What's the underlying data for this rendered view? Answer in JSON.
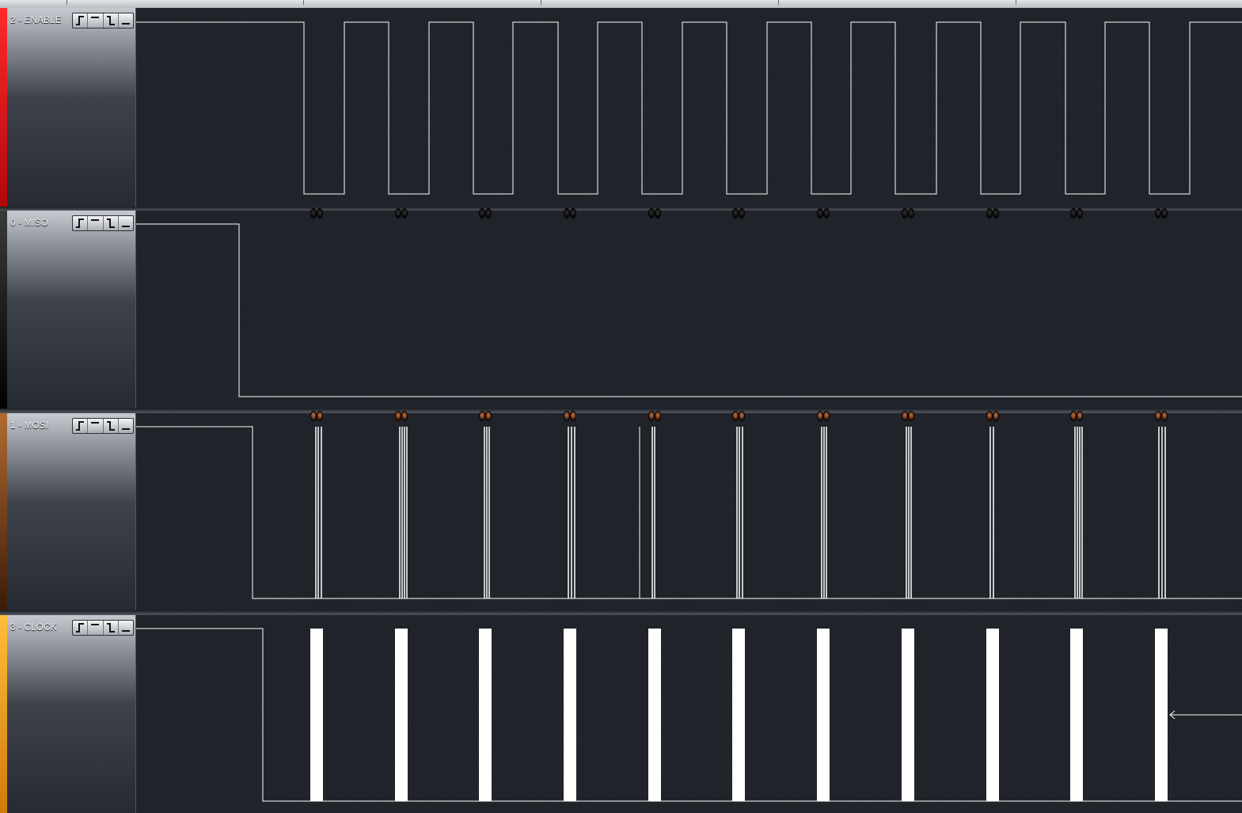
{
  "app": {
    "colors": {
      "background": "#1e2127",
      "trace": "#ffffff",
      "enable_strip": "#e0141c",
      "miso_strip": "#0d0d0d",
      "mosi_strip": "#8a4a1f",
      "clock_strip": "#f0a020"
    }
  },
  "channels": [
    {
      "id": "enable",
      "name": "2 - ENABLE",
      "color": "#e0141c"
    },
    {
      "id": "miso",
      "name": "0 - MISO",
      "color": "#0d0d0d"
    },
    {
      "id": "mosi",
      "name": "1 - MOSI",
      "color": "#8a4a1f"
    },
    {
      "id": "clock",
      "name": "3 - CLOCK",
      "color": "#f0a020"
    }
  ],
  "trigger_buttons": [
    {
      "name": "rising-edge",
      "glyph": "┐┘"
    },
    {
      "name": "high-level",
      "glyph": "‾"
    },
    {
      "name": "falling-edge",
      "glyph": "┘"
    },
    {
      "name": "low-level",
      "glyph": "_"
    }
  ],
  "icons": [
    "rising-edge-trigger-icon",
    "high-level-trigger-icon",
    "falling-edge-trigger-icon",
    "low-level-trigger-icon",
    "sample-marker-icon",
    "arrow-left-icon"
  ]
}
